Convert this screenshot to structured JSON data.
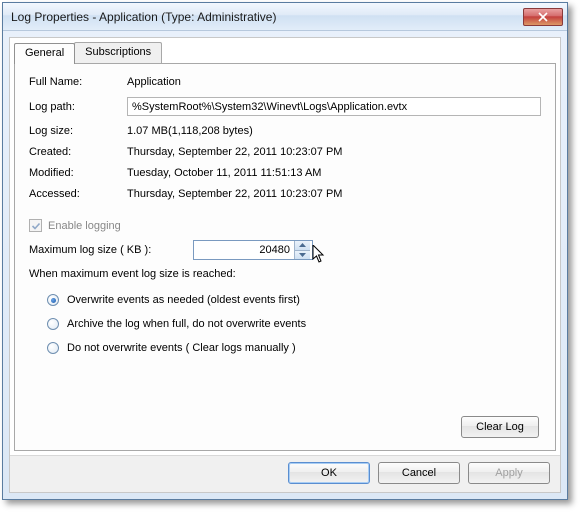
{
  "window": {
    "title": "Log Properties - Application (Type: Administrative)"
  },
  "tabs": {
    "general": "General",
    "subscriptions": "Subscriptions"
  },
  "labels": {
    "full_name": "Full Name:",
    "log_path": "Log path:",
    "log_size": "Log size:",
    "created": "Created:",
    "modified": "Modified:",
    "accessed": "Accessed:",
    "enable_logging": "Enable logging",
    "max_size": "Maximum log size ( KB ):",
    "when_reached": "When maximum event log size is reached:"
  },
  "values": {
    "full_name": "Application",
    "log_path": "%SystemRoot%\\System32\\Winevt\\Logs\\Application.evtx",
    "log_size": "1.07 MB(1,118,208 bytes)",
    "created": "Thursday, September 22, 2011 10:23:07 PM",
    "modified": "Tuesday, October 11, 2011 11:51:13 AM",
    "accessed": "Thursday, September 22, 2011 10:23:07 PM",
    "max_size": "20480"
  },
  "radios": {
    "overwrite": "Overwrite events as needed (oldest events first)",
    "archive": "Archive the log when full, do not overwrite events",
    "manual": "Do not overwrite events ( Clear logs manually )"
  },
  "buttons": {
    "clear_log": "Clear Log",
    "ok": "OK",
    "cancel": "Cancel",
    "apply": "Apply"
  }
}
